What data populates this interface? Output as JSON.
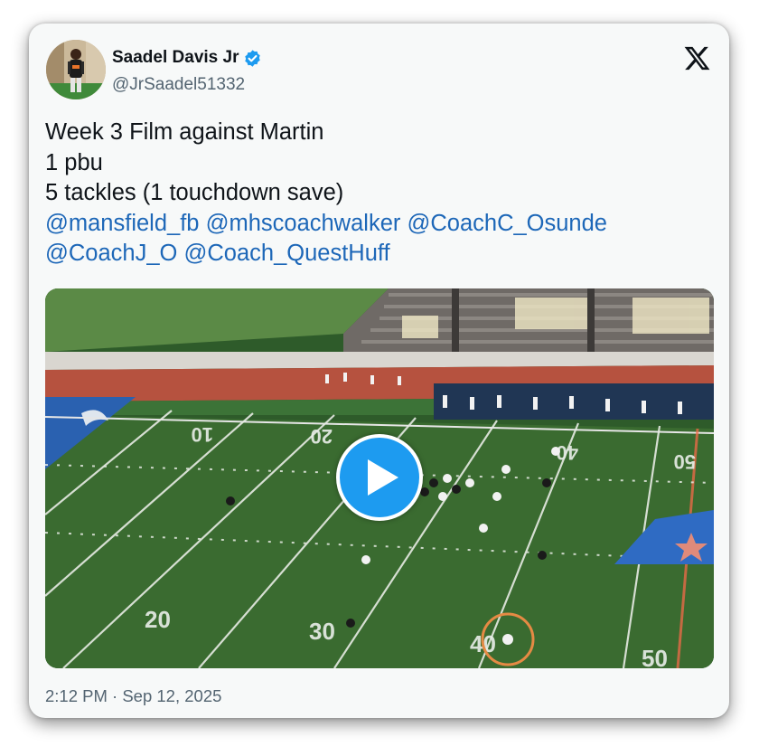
{
  "author": {
    "name": "Saadel Davis Jr",
    "handle": "@JrSaadel51332",
    "verified": true,
    "avatar_icon": "profile-photo"
  },
  "platform_icon": "x-logo-icon",
  "tweet": {
    "lines": [
      "Week 3 Film against Martin",
      "1 pbu",
      "5 tackles (1 touchdown save)"
    ],
    "mentions_line1": [
      "@mansfield_fb",
      "@mhscoachwalker",
      "@CoachC_Osunde"
    ],
    "mentions_line2": [
      "@CoachJ_O",
      "@Coach_QuestHuff"
    ]
  },
  "media": {
    "type": "video",
    "thumbnail": "football-field-aerial",
    "play_icon": "play-icon",
    "field_numbers": [
      "10",
      "20",
      "20",
      "30",
      "40",
      "40",
      "50",
      "50"
    ]
  },
  "timestamp": "2:12 PM · Sep 12, 2025",
  "colors": {
    "accent": "#1d9bf0",
    "mention": "#1d67b8",
    "card_bg": "#f7f9f9",
    "verified": "#1d9bf0"
  }
}
